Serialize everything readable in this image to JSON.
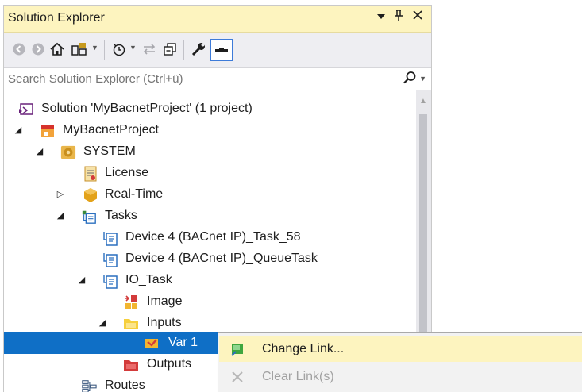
{
  "window": {
    "title": "Solution Explorer",
    "dropdown_icon": "chevron-down-icon",
    "pin_icon": "pin-icon",
    "close_icon": "close-icon",
    "title_bg": "#fdf4bf"
  },
  "toolbar": {
    "buttons": [
      "back-icon",
      "forward-icon",
      "home-icon",
      "switch-views-icon",
      "pending-changes-icon",
      "sync-icon",
      "collapse-all-icon",
      "properties-icon",
      "preview-icon"
    ]
  },
  "search": {
    "placeholder": "Search Solution Explorer (Ctrl+ü)"
  },
  "tree": {
    "rows": [
      {
        "label": "Solution 'MyBacnetProject' (1 project)",
        "icon": "solution-icon",
        "expander": "none"
      },
      {
        "label": "MyBacnetProject",
        "icon": "project-icon",
        "expander": "expanded"
      },
      {
        "label": "SYSTEM",
        "icon": "system-icon",
        "expander": "expanded"
      },
      {
        "label": "License",
        "icon": "license-icon",
        "expander": "none"
      },
      {
        "label": "Real-Time",
        "icon": "realtime-icon",
        "expander": "collapsed"
      },
      {
        "label": "Tasks",
        "icon": "tasks-icon",
        "expander": "expanded"
      },
      {
        "label": "Device 4 (BACnet IP)_Task_58",
        "icon": "task-icon",
        "expander": "none"
      },
      {
        "label": "Device 4 (BACnet IP)_QueueTask",
        "icon": "task-icon",
        "expander": "none"
      },
      {
        "label": "IO_Task",
        "icon": "task-icon",
        "expander": "expanded"
      },
      {
        "label": "Image",
        "icon": "image-icon",
        "expander": "none"
      },
      {
        "label": "Inputs",
        "icon": "inputs-folder-icon",
        "expander": "expanded"
      },
      {
        "label": "Var 1",
        "icon": "variable-icon",
        "expander": "none",
        "selected": true
      },
      {
        "label": "Outputs",
        "icon": "outputs-folder-icon",
        "expander": "none"
      },
      {
        "label": "Routes",
        "icon": "routes-icon",
        "expander": "none"
      }
    ],
    "selection_color": "#0f6fc6"
  },
  "context_menu": {
    "items": [
      {
        "label": "Change Link...",
        "icon": "change-link-icon",
        "enabled": true,
        "hover": true
      },
      {
        "label": "Clear Link(s)",
        "icon": "clear-link-icon",
        "enabled": false
      }
    ],
    "hover_color": "#fdf4bf"
  }
}
